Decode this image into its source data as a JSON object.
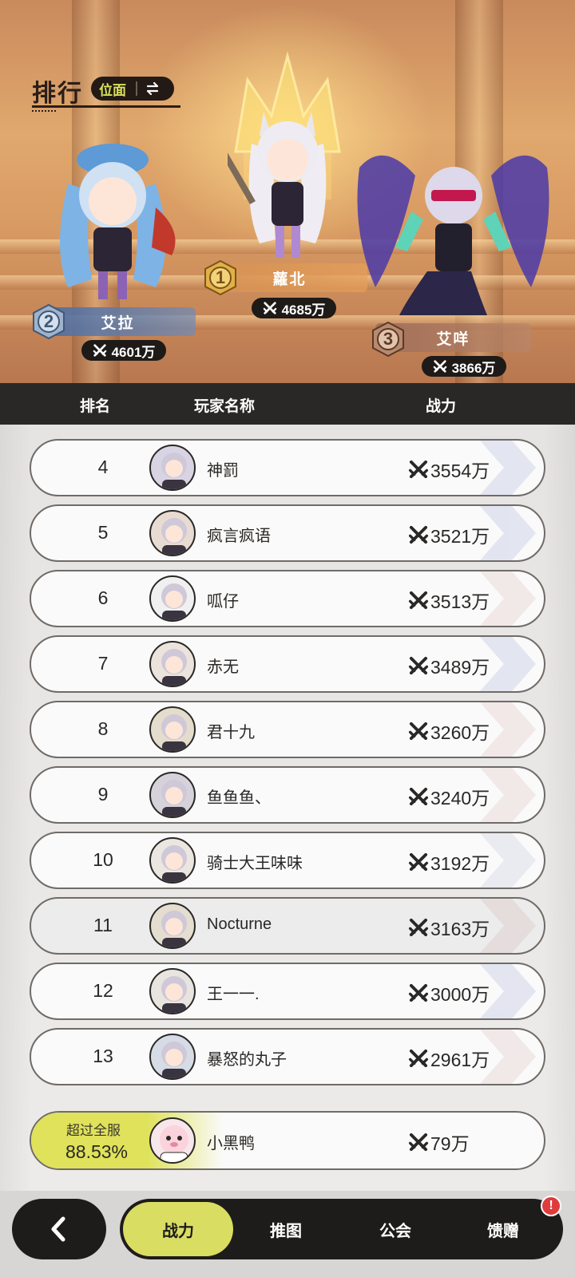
{
  "header": {
    "title": "排行",
    "scope_label": "位面"
  },
  "podium": {
    "first": {
      "rank": "1",
      "name": "蘿北",
      "power": "4685万"
    },
    "second": {
      "rank": "2",
      "name": "艾拉",
      "power": "4601万"
    },
    "third": {
      "rank": "3",
      "name": "艾咩",
      "power": "3866万"
    }
  },
  "table": {
    "columns": {
      "rank": "排名",
      "name": "玩家名称",
      "power": "战力"
    },
    "rows": [
      {
        "rank": "4",
        "name": "神罰",
        "power": "3554万"
      },
      {
        "rank": "5",
        "name": "疯言疯语",
        "power": "3521万"
      },
      {
        "rank": "6",
        "name": "呱仔",
        "power": "3513万"
      },
      {
        "rank": "7",
        "name": "赤无",
        "power": "3489万"
      },
      {
        "rank": "8",
        "name": "君十九",
        "power": "3260万"
      },
      {
        "rank": "9",
        "name": "鱼鱼鱼、",
        "power": "3240万"
      },
      {
        "rank": "10",
        "name": "骑士大王味味",
        "power": "3192万"
      },
      {
        "rank": "11",
        "name": "Nocturne",
        "power": "3163万"
      },
      {
        "rank": "12",
        "name": "王一一.",
        "power": "3000万"
      },
      {
        "rank": "13",
        "name": "暴怒的丸子",
        "power": "2961万"
      }
    ]
  },
  "self": {
    "caption": "超过全服",
    "percent": "88.53%",
    "name": "小黑鸭",
    "power": "79万"
  },
  "nav": {
    "tabs": [
      {
        "label": "战力",
        "active": true
      },
      {
        "label": "推图",
        "active": false
      },
      {
        "label": "公会",
        "active": false
      },
      {
        "label": "馈赠",
        "active": false
      }
    ],
    "alert": "!"
  },
  "colors": {
    "accent": "#d9dd62",
    "dark": "#1e1c1b",
    "alert": "#e03b3b"
  }
}
